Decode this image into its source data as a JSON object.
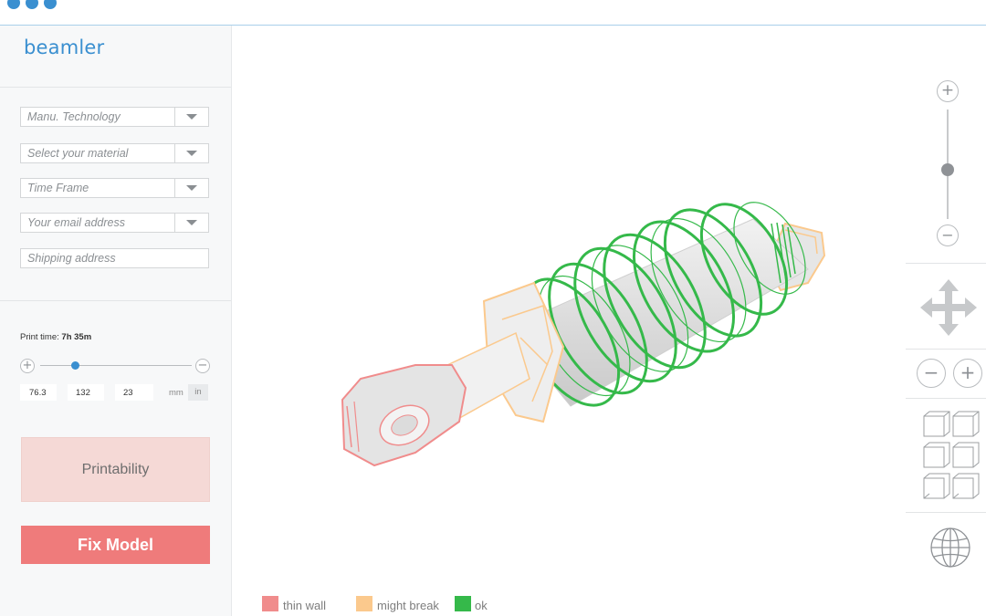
{
  "app": {
    "logo": "beamler"
  },
  "form": {
    "technology": "Manu. Technology",
    "material": "Select your material",
    "timeframe": "Time Frame",
    "email": "Your email address",
    "shipping": "Shipping address"
  },
  "print": {
    "time_label": "Print time:",
    "time_value": "7h 35m",
    "scale_fraction": 0.23,
    "dims": [
      "76.3",
      "132",
      "23"
    ],
    "unit_mm": "mm",
    "unit_in": "in"
  },
  "buttons": {
    "printability": "Printability",
    "fix_model": "Fix Model"
  },
  "viewer": {
    "zoom_fraction": 0.55
  },
  "legend": [
    {
      "label": "thin wall",
      "color": "#f08c8c"
    },
    {
      "label": "might break",
      "color": "#fbc98d"
    },
    {
      "label": "ok",
      "color": "#35b94a"
    }
  ],
  "colors": {
    "accent": "#3a8fd0",
    "fix": "#ef7b7b",
    "printability_bg": "#f5d9d6"
  }
}
